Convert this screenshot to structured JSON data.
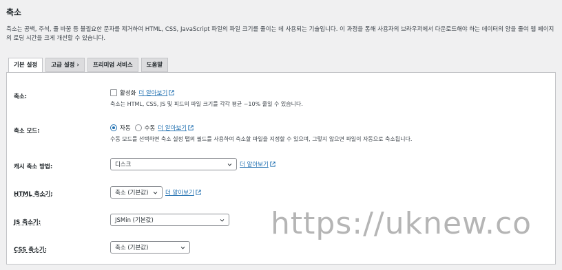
{
  "page": {
    "title": "축소",
    "description": "축소는 공백, 주석, 줄 바꿈 등 불필요한 문자를 제거하여 HTML, CSS, JavaScript 파일의 파일 크기를 줄이는 데 사용되는 기술입니다. 이 과정을 통해 사용자의 브라우저에서 다운로드해야 하는 데이터의 양을 줄여 웹 페이지의 로딩 시간을 크게 개선할 수 있습니다."
  },
  "tabs": [
    {
      "label": "기본 설정",
      "active": true
    },
    {
      "label": "고급 설정 ›"
    },
    {
      "label": "프리미엄 서비스"
    },
    {
      "label": "도움말"
    }
  ],
  "fields": {
    "minify": {
      "label": "축소:",
      "checkbox_label": "활성화",
      "checked": false,
      "link": "더 알아보기",
      "note": "축소는 HTML, CSS, JS 및 피드의 파일 크기를 각각 평균 ~10% 줄일 수 있습니다."
    },
    "mode": {
      "label": "축소 모드:",
      "option_auto": "자동",
      "option_manual": "수동",
      "selected": "자동",
      "link": "더 알아보기",
      "note": "수동 모드를 선택하면 축소 설정 탭의 필드를 사용하여 축소할 파일을 지정할 수 있으며, 그렇지 않으면 파일이 자동으로 축소됩니다."
    },
    "cache": {
      "label": "캐시 축소 방법:",
      "value": "디스크",
      "link": "더 알아보기"
    },
    "html": {
      "label": "HTML 축소기:",
      "value": "축소 (기본값)",
      "link": "더 알아보기"
    },
    "js": {
      "label": "JS 축소기:",
      "value": "JSMin (기본값)"
    },
    "css": {
      "label": "CSS 축소기:",
      "value": "축소 (기본값)"
    }
  },
  "watermark": "https://uknew.co",
  "icons": {
    "external": "external-link-icon",
    "chevron": "chevron-down-icon"
  },
  "colors": {
    "link": "#2271b1",
    "accent": "#2271b1"
  }
}
